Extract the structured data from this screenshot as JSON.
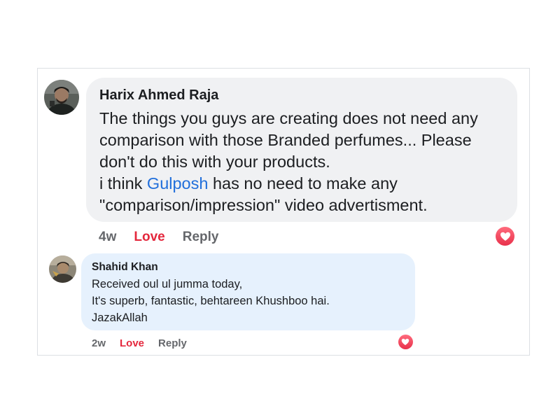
{
  "comments": [
    {
      "author": "Harix Ahmed Raja",
      "lines": [
        "The things you guys are creating does not need any",
        "comparison with those Branded perfumes... Please",
        "don't do this with your products."
      ],
      "mention_line": {
        "before": "i think ",
        "mention": "Gulposh",
        "after": " has no need to make any"
      },
      "last_line": "\"comparison/impression\" video advertisment.",
      "time": "4w",
      "love_label": "Love",
      "reply_label": "Reply",
      "reaction_icon": "heart-icon"
    },
    {
      "author": "Shahid Khan",
      "lines": [
        "Received oul ul jumma today,",
        "It's superb, fantastic, behtareen Khushboo hai.",
        "JazakAllah"
      ],
      "time": "2w",
      "love_label": "Love",
      "reply_label": "Reply",
      "reaction_icon": "heart-icon"
    }
  ],
  "colors": {
    "mention": "#216fdb",
    "love": "#e4283d",
    "bubble_main": "#f0f1f3",
    "bubble_reply": "#e6f1fd"
  }
}
